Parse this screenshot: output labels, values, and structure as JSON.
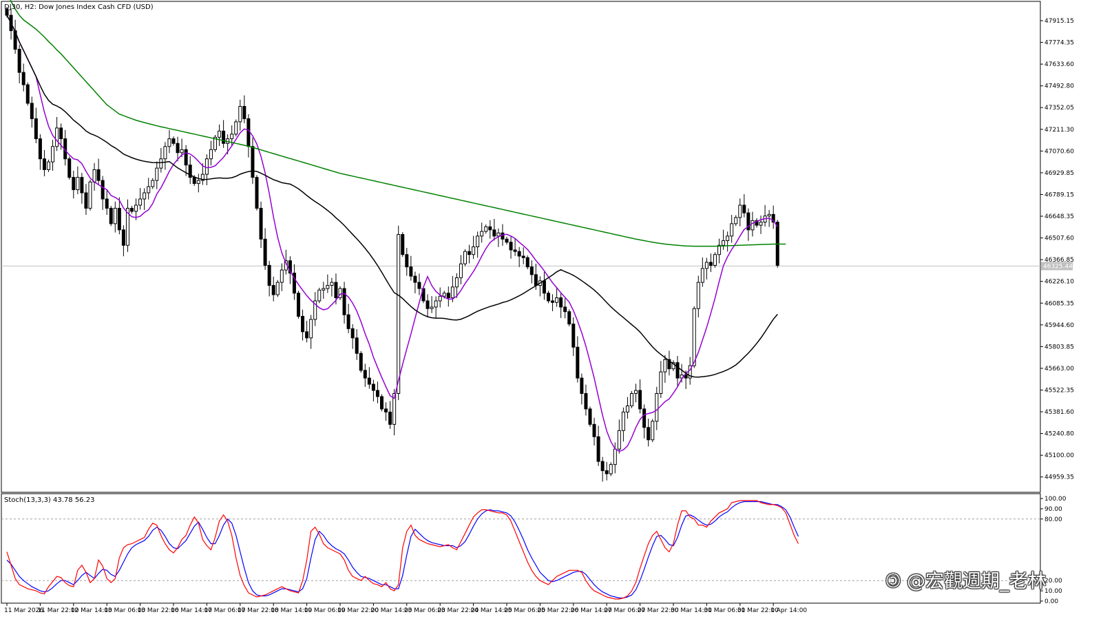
{
  "chart_data": {
    "type": "candlestick",
    "title": "DJ30, H2:  Dow Jones Index Cash CFD (USD)",
    "symbol": "DJ30",
    "timeframe": "H2",
    "instrument": "Dow Jones Index Cash CFD (USD)",
    "ylim": [
      44860,
      48040
    ],
    "y_ticks": [
      "47915.15",
      "47774.35",
      "47633.60",
      "47492.80",
      "47352.05",
      "47211.30",
      "47070.60",
      "46929.85",
      "46789.15",
      "46648.35",
      "46507.60",
      "46366.85",
      "46226.10",
      "46085.35",
      "45944.60",
      "45803.85",
      "45663.00",
      "45522.35",
      "45381.60",
      "45240.80",
      "45100.00",
      "44959.35"
    ],
    "current_price": "46325.44",
    "current_value": 46325.44,
    "x_labels": [
      "11 Mar 2026",
      "11 Mar 22:00",
      "12 Mar 14:00",
      "13 Mar 06:00",
      "13 Mar 22:00",
      "16 Mar 14:00",
      "17 Mar 06:00",
      "17 Mar 22:00",
      "18 Mar 14:00",
      "19 Mar 06:00",
      "19 Mar 22:00",
      "20 Mar 14:00",
      "23 Mar 06:00",
      "23 Mar 22:00",
      "24 Mar 14:00",
      "25 Mar 06:00",
      "25 Mar 22:00",
      "26 Mar 14:00",
      "27 Mar 06:00",
      "27 Mar 22:00",
      "30 Mar 14:00",
      "31 Mar 06:00",
      "31 Mar 22:00",
      "1 Apr 14:00"
    ],
    "x_label_bars": [
      0,
      8,
      16,
      24,
      32,
      40,
      48,
      56,
      64,
      72,
      80,
      88,
      96,
      104,
      112,
      120,
      128,
      136,
      144,
      152,
      160,
      168,
      176,
      184
    ],
    "closes": [
      47950,
      47850,
      47730,
      47580,
      47500,
      47380,
      47280,
      47150,
      47020,
      46950,
      47000,
      47100,
      47220,
      47150,
      47020,
      46900,
      46820,
      46900,
      46800,
      46700,
      46870,
      46950,
      46880,
      46760,
      46700,
      46600,
      46700,
      46560,
      46460,
      46700,
      46680,
      46720,
      46760,
      46800,
      46840,
      46880,
      46960,
      47020,
      47100,
      47150,
      47120,
      47060,
      47080,
      46980,
      46900,
      46860,
      46880,
      46920,
      47020,
      47080,
      47160,
      47200,
      47120,
      47150,
      47180,
      47260,
      47360,
      47280,
      47100,
      46900,
      46700,
      46500,
      46330,
      46200,
      46140,
      46220,
      46300,
      46360,
      46280,
      46150,
      46000,
      45900,
      45860,
      45980,
      46100,
      46170,
      46180,
      46200,
      46220,
      46120,
      46180,
      46010,
      45920,
      45860,
      45760,
      45650,
      45600,
      45560,
      45520,
      45480,
      45400,
      45380,
      45300,
      45500,
      46530,
      46400,
      46320,
      46260,
      46220,
      46180,
      46100,
      46050,
      46060,
      46100,
      46130,
      46150,
      46120,
      46190,
      46250,
      46340,
      46420,
      46400,
      46450,
      46520,
      46550,
      46580,
      46560,
      46520,
      46540,
      46500,
      46480,
      46430,
      46420,
      46390,
      46380,
      46320,
      46270,
      46200,
      46230,
      46150,
      46100,
      46090,
      46120,
      46060,
      46030,
      45950,
      45800,
      45600,
      45500,
      45400,
      45300,
      45220,
      45060,
      45000,
      44980,
      45040,
      45140,
      45260,
      45380,
      45420,
      45500,
      45520,
      45400,
      45280,
      45200,
      45320,
      45500,
      45640,
      45720,
      45660,
      45700,
      45600,
      45620,
      45600,
      45680,
      46050,
      46220,
      46310,
      46350,
      46330,
      46400,
      46460,
      46490,
      46520,
      46600,
      46640,
      46720,
      46670,
      46560,
      46620,
      46590,
      46610,
      46650,
      46660,
      46610,
      46330
    ]
  },
  "oscillator": {
    "label": "Stoch(13,3,3) 43.78 56.23",
    "ylim": [
      0,
      100
    ],
    "y_ticks": [
      "100.00",
      "90.00",
      "80.00",
      "20.00",
      "10.00",
      "0.00"
    ],
    "levels": [
      20,
      80
    ],
    "main_color": "#ff0000",
    "signal_color": "#0000ff",
    "main": [
      48,
      35,
      22,
      16,
      14,
      12,
      11,
      10,
      8,
      7,
      14,
      19,
      24,
      23,
      18,
      15,
      14,
      30,
      35,
      28,
      18,
      22,
      40,
      34,
      22,
      18,
      22,
      42,
      52,
      55,
      56,
      58,
      60,
      62,
      70,
      76,
      74,
      64,
      56,
      50,
      47,
      52,
      60,
      64,
      74,
      82,
      76,
      60,
      54,
      50,
      62,
      78,
      84,
      78,
      64,
      42,
      25,
      15,
      8,
      6,
      4,
      5,
      6,
      8,
      10,
      12,
      14,
      12,
      10,
      9,
      8,
      20,
      40,
      68,
      72,
      65,
      56,
      52,
      50,
      48,
      46,
      40,
      30,
      24,
      22,
      20,
      24,
      20,
      17,
      16,
      14,
      18,
      12,
      10,
      16,
      52,
      68,
      74,
      64,
      60,
      58,
      56,
      55,
      54,
      53,
      54,
      55,
      52,
      50,
      58,
      66,
      74,
      82,
      86,
      89,
      89,
      88,
      87,
      86,
      86,
      84,
      78,
      68,
      58,
      48,
      38,
      30,
      24,
      20,
      18,
      16,
      20,
      24,
      26,
      28,
      30,
      30,
      30,
      28,
      20,
      14,
      10,
      8,
      6,
      4,
      3,
      2,
      2,
      3,
      5,
      10,
      18,
      32,
      44,
      56,
      64,
      68,
      60,
      52,
      48,
      56,
      74,
      88,
      88,
      82,
      80,
      74,
      74,
      72,
      78,
      82,
      86,
      88,
      90,
      96,
      97,
      98,
      98,
      98,
      98,
      98,
      96,
      95,
      94,
      94,
      93,
      91,
      86,
      75,
      64,
      56
    ],
    "signal": [
      40,
      36,
      30,
      24,
      20,
      17,
      14,
      12,
      10,
      9,
      10,
      13,
      17,
      20,
      20,
      18,
      16,
      20,
      25,
      28,
      25,
      22,
      27,
      31,
      30,
      26,
      24,
      30,
      38,
      46,
      52,
      55,
      57,
      59,
      63,
      69,
      72,
      69,
      63,
      56,
      52,
      51,
      55,
      59,
      66,
      73,
      77,
      70,
      62,
      56,
      56,
      64,
      74,
      80,
      76,
      64,
      48,
      32,
      18,
      10,
      6,
      5,
      5,
      6,
      8,
      10,
      12,
      12,
      11,
      10,
      9,
      12,
      22,
      42,
      60,
      68,
      64,
      58,
      54,
      51,
      49,
      46,
      40,
      33,
      28,
      24,
      23,
      22,
      20,
      18,
      16,
      16,
      14,
      12,
      12,
      25,
      45,
      63,
      70,
      66,
      62,
      59,
      57,
      56,
      55,
      54,
      54,
      54,
      52,
      54,
      58,
      65,
      73,
      80,
      85,
      88,
      89,
      88,
      88,
      87,
      86,
      83,
      77,
      69,
      60,
      50,
      42,
      35,
      28,
      24,
      20,
      19,
      20,
      22,
      24,
      26,
      28,
      29,
      29,
      26,
      21,
      16,
      12,
      9,
      7,
      5,
      4,
      3,
      3,
      4,
      6,
      11,
      20,
      31,
      43,
      54,
      63,
      64,
      60,
      55,
      54,
      62,
      74,
      83,
      84,
      82,
      79,
      76,
      74,
      75,
      78,
      82,
      85,
      87,
      91,
      94,
      96,
      97,
      97,
      97,
      97,
      97,
      96,
      95,
      94,
      94,
      92,
      89,
      82,
      72,
      63
    ]
  },
  "indicators": {
    "ma_fast_color": "#9400d3",
    "ma_mid_color": "#000000",
    "ma_slow_color": "#008000",
    "ma_slow_values": [
      48100,
      48040,
      47990,
      47950,
      47920,
      47900,
      47880,
      47860,
      47835,
      47810,
      47780,
      47755,
      47725,
      47700,
      47670,
      47640,
      47610,
      47580,
      47550,
      47520,
      47490,
      47460,
      47430,
      47400,
      47370,
      47350,
      47330,
      47310,
      47300,
      47290,
      47280,
      47270,
      47262,
      47255,
      47248,
      47241,
      47234,
      47228,
      47222,
      47216,
      47210,
      47204,
      47198,
      47192,
      47186,
      47180,
      47174,
      47168,
      47162,
      47156,
      47150,
      47144,
      47138,
      47132,
      47126,
      47120,
      47114,
      47108,
      47102,
      47094,
      47086,
      47078,
      47070,
      47062,
      47054,
      47046,
      47038,
      47030,
      47022,
      47014,
      47006,
      46998,
      46990,
      46982,
      46974,
      46966,
      46958,
      46950,
      46942,
      46934,
      46926,
      46920,
      46914,
      46908,
      46902,
      46896,
      46890,
      46884,
      46878,
      46872,
      46866,
      46860,
      46854,
      46848,
      46842,
      46836,
      46830,
      46824,
      46818,
      46812,
      46806,
      46800,
      46794,
      46788,
      46782,
      46776,
      46770,
      46764,
      46758,
      46752,
      46746,
      46740,
      46734,
      46728,
      46722,
      46716,
      46710,
      46704,
      46698,
      46692,
      46686,
      46680,
      46674,
      46668,
      46662,
      46656,
      46650,
      46644,
      46638,
      46632,
      46626,
      46620,
      46614,
      46608,
      46602,
      46596,
      46590,
      46584,
      46578,
      46572,
      46566,
      46560,
      46554,
      46548,
      46542,
      46536,
      46530,
      46524,
      46518,
      46512,
      46506,
      46500,
      46495,
      46490,
      46485,
      46480,
      46476,
      46472,
      46468,
      46465,
      46462,
      46460,
      46458,
      46456,
      46455,
      46454,
      46454,
      46454,
      46454,
      46454,
      46454,
      46455,
      46456,
      46457,
      46458,
      46459,
      46460,
      46461,
      46462,
      46463,
      46464,
      46465,
      46466,
      46467,
      46468,
      46468,
      46468,
      46468
    ]
  }
}
